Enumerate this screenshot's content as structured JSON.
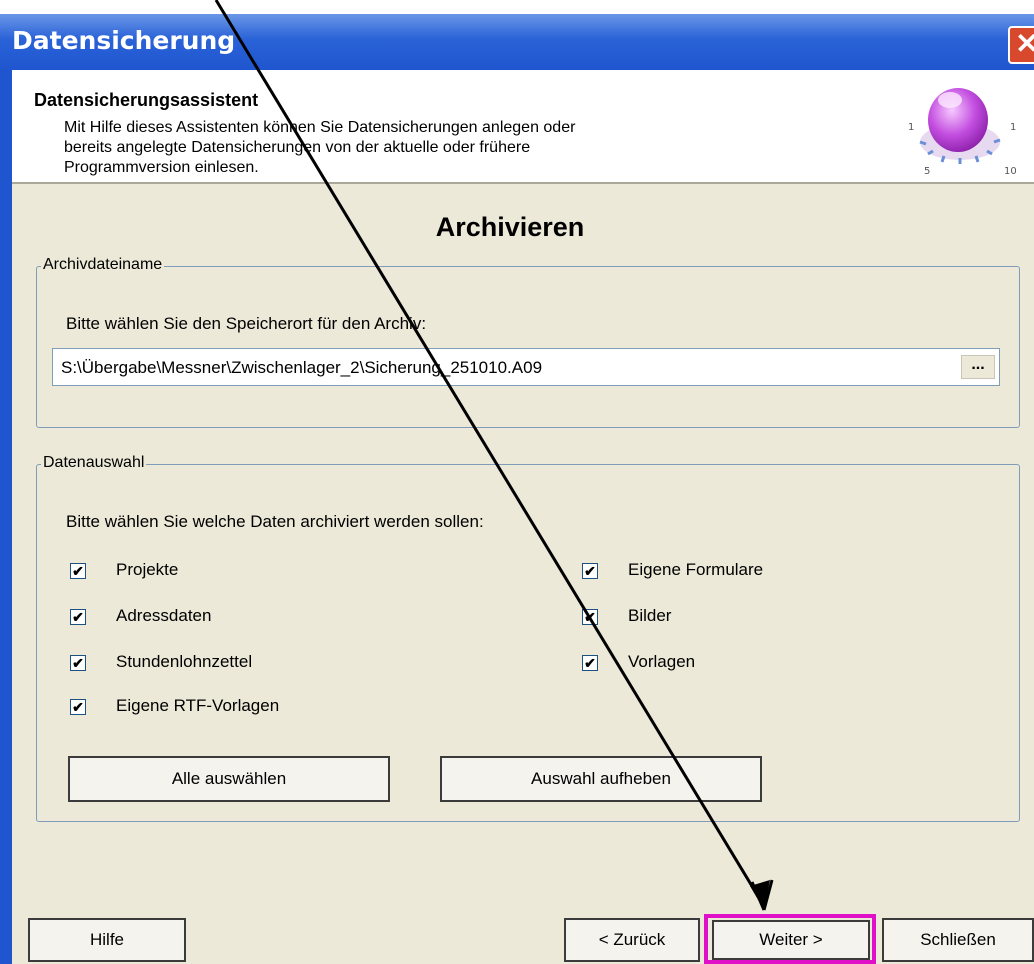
{
  "window": {
    "title": "Datensicherung",
    "close_glyph": "✕"
  },
  "header": {
    "title": "Datensicherungsassistent",
    "description_lines": [
      "Mit Hilfe dieses Assistenten können Sie Datensicherungen anlegen oder",
      "bereits angelegte Datensicherungen von der aktuelle oder frühere",
      "Programmversion einlesen."
    ],
    "icon": "knob-dial-icon",
    "dial_labels": [
      "1",
      "1",
      "5",
      "10"
    ]
  },
  "page": {
    "heading": "Archivieren"
  },
  "archive_group": {
    "label": "Archivdateiname",
    "prompt": "Bitte wählen Sie den Speicherort für den Archiv:",
    "path_value": "S:\\Übergabe\\Messner\\Zwischenlager_2\\Sicherung_251010.A09",
    "browse_label": "..."
  },
  "data_group": {
    "label": "Datenauswahl",
    "prompt": "Bitte wählen Sie welche Daten archiviert werden sollen:",
    "checkboxes_left": [
      {
        "label": "Projekte",
        "checked": true
      },
      {
        "label": "Adressdaten",
        "checked": true
      },
      {
        "label": "Stundenlohnzettel",
        "checked": true
      },
      {
        "label": "Eigene RTF-Vorlagen",
        "checked": true
      }
    ],
    "checkboxes_right": [
      {
        "label": "Eigene Formulare",
        "checked": true
      },
      {
        "label": "Bilder",
        "checked": true
      },
      {
        "label": "Vorlagen",
        "checked": true
      }
    ],
    "check_glyph": "✔",
    "select_all_label": "Alle auswählen",
    "deselect_label": "Auswahl aufheben"
  },
  "footer": {
    "help_label": "Hilfe",
    "back_label": "< Zurück",
    "next_label": "Weiter >",
    "close_label": "Schließen"
  },
  "colors": {
    "title_bar": "#2a62d8",
    "highlight": "#e010c8",
    "dialog_bg": "#ece9d8"
  }
}
